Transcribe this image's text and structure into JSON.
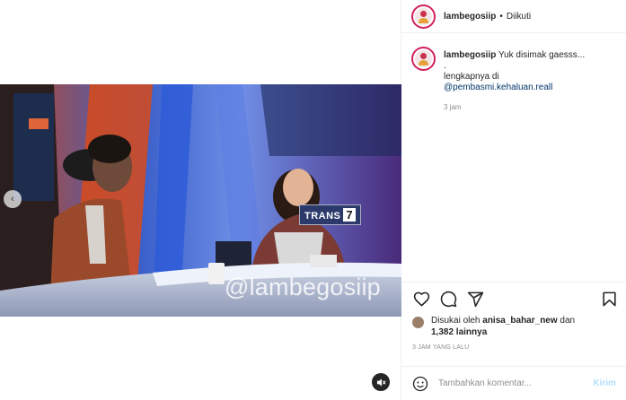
{
  "post": {
    "username": "lambegosiip",
    "follow_status": "Diikuti",
    "separator": "•"
  },
  "media": {
    "watermark": "@lambegosiip",
    "channel_logo": "TRANS",
    "channel_number": "7",
    "prev_icon": "chevron-left-icon",
    "mute_icon": "speaker-muted-icon"
  },
  "caption": {
    "username": "lambegosiip",
    "text": "Yuk disimak gaesss...",
    "line2": ".",
    "line3": "lengkapnya di",
    "mention": "@pembasmi.kehaluan.reall",
    "time": "3 jam"
  },
  "actions": {
    "like_icon": "heart-icon",
    "comment_icon": "comment-icon",
    "share_icon": "share-icon",
    "save_icon": "bookmark-icon"
  },
  "likes": {
    "prefix": "Disukai oleh",
    "user": "anisa_bahar_new",
    "joiner": "dan",
    "count_text": "1,382 lainnya"
  },
  "date": "3 JAM YANG LALU",
  "comment_box": {
    "placeholder": "Tambahkan komentar...",
    "post_label": "Kirim",
    "emoji_icon": "emoji-icon"
  },
  "colors": {
    "accent": "#0095f6",
    "post_disabled": "#b2dffc",
    "mention": "#00376b",
    "story_ring": "#d2205e"
  }
}
